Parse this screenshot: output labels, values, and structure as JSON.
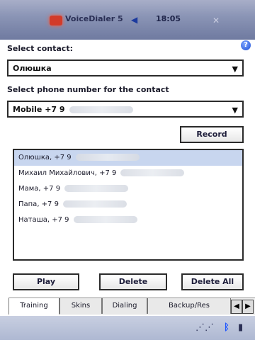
{
  "titlebar": {
    "title": "VoiceDialer 5",
    "time": "18:05"
  },
  "form": {
    "select_contact_label": "Select contact:",
    "contact_value": "Олюшка",
    "select_phone_label": "Select phone number for the contact",
    "phone_value": "Mobile +7 9"
  },
  "buttons": {
    "record": "Record",
    "play": "Play",
    "delete": "Delete",
    "delete_all": "Delete All"
  },
  "contacts_list": [
    "Олюшка, +7 9",
    "Михаил Михайлович, +7 9",
    "Мама, +7 9",
    "Папа, +7 9",
    "Наташа, +7 9"
  ],
  "tabs": [
    "Training",
    "Skins",
    "Dialing",
    "Backup/Res"
  ],
  "icons": {
    "help": "help-icon",
    "volume": "volume-icon",
    "close": "close-icon",
    "bluetooth": "bluetooth-icon"
  }
}
